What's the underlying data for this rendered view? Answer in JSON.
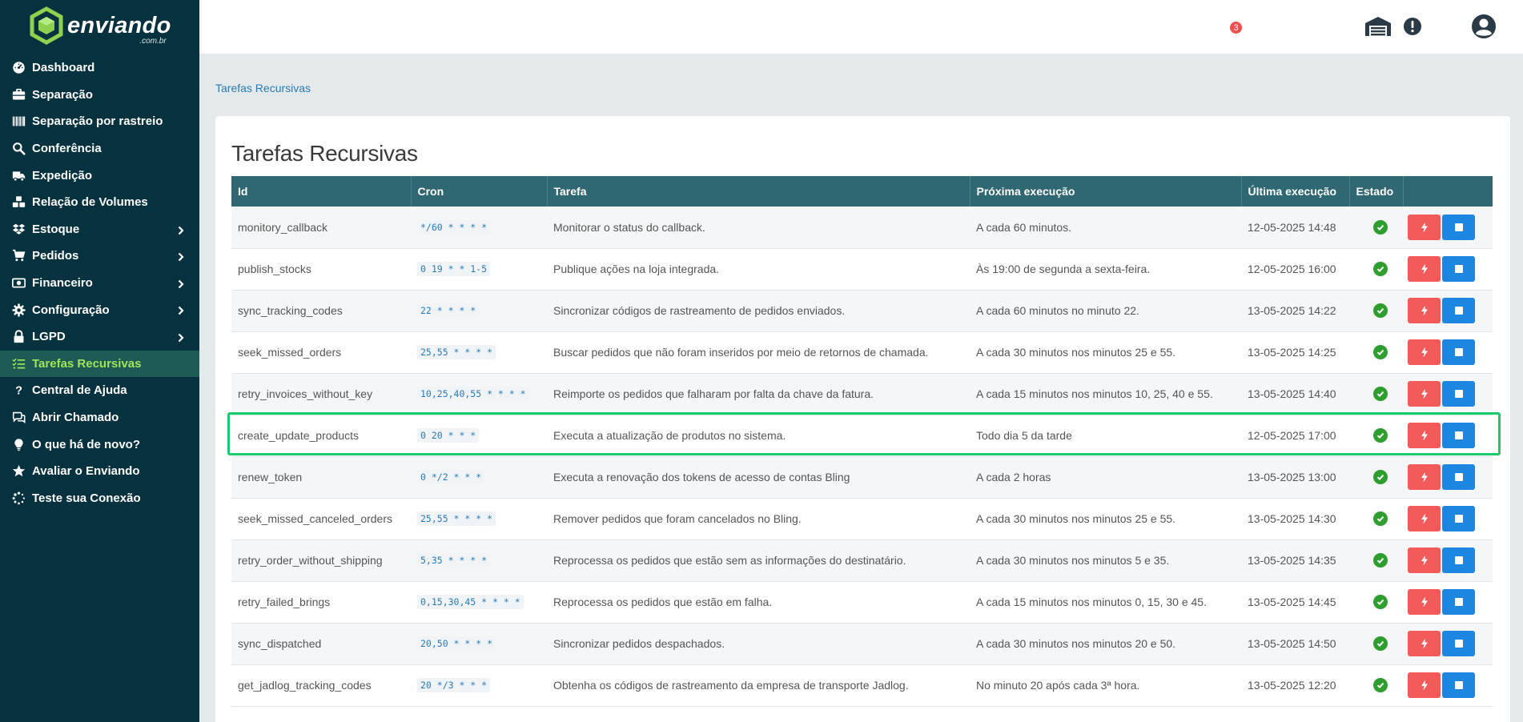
{
  "brand": {
    "name": "enviando",
    "sub": ".com.br"
  },
  "sidebar": {
    "items": [
      {
        "label": "Dashboard",
        "icon": "dashboard-icon",
        "chevron": false,
        "active": false
      },
      {
        "label": "Separação",
        "icon": "briefcase-icon",
        "chevron": false,
        "active": false
      },
      {
        "label": "Separação por rastreio",
        "icon": "barcode-icon",
        "chevron": false,
        "active": false
      },
      {
        "label": "Conferência",
        "icon": "search-icon",
        "chevron": false,
        "active": false
      },
      {
        "label": "Expedição",
        "icon": "truck-icon",
        "chevron": false,
        "active": false
      },
      {
        "label": "Relação de Volumes",
        "icon": "boxes-icon",
        "chevron": false,
        "active": false
      },
      {
        "label": "Estoque",
        "icon": "dropbox-icon",
        "chevron": true,
        "active": false
      },
      {
        "label": "Pedidos",
        "icon": "cart-icon",
        "chevron": true,
        "active": false
      },
      {
        "label": "Financeiro",
        "icon": "money-icon",
        "chevron": true,
        "active": false
      },
      {
        "label": "Configuração",
        "icon": "gear-icon",
        "chevron": true,
        "active": false
      },
      {
        "label": "LGPD",
        "icon": "lock-icon",
        "chevron": true,
        "active": false
      },
      {
        "label": "Tarefas Recursivas",
        "icon": "tasks-icon",
        "chevron": false,
        "active": true
      },
      {
        "label": "Central de Ajuda",
        "icon": "question-icon",
        "chevron": false,
        "active": false
      },
      {
        "label": "Abrir Chamado",
        "icon": "comments-icon",
        "chevron": false,
        "active": false
      },
      {
        "label": "O que há de novo?",
        "icon": "lightbulb-icon",
        "chevron": false,
        "active": false
      },
      {
        "label": "Avaliar o Enviando",
        "icon": "star-icon",
        "chevron": false,
        "active": false
      },
      {
        "label": "Teste sua Conexão",
        "icon": "spinner-icon",
        "chevron": false,
        "active": false
      }
    ]
  },
  "header": {
    "notifications_count": "3"
  },
  "breadcrumb": "Tarefas Recursivas",
  "page_title": "Tarefas Recursivas",
  "table": {
    "columns": [
      "Id",
      "Cron",
      "Tarefa",
      "Próxima execução",
      "Última execução",
      "Estado",
      ""
    ],
    "rows": [
      {
        "id": "monitory_callback",
        "cron": "*/60 * * * *",
        "task": "Monitorar o status do callback.",
        "next": "A cada 60 minutos.",
        "last": "12-05-2025 14:48"
      },
      {
        "id": "publish_stocks",
        "cron": "0 19 * * 1-5",
        "task": "Publique ações na loja integrada.",
        "next": "Às 19:00 de segunda a sexta-feira.",
        "last": "12-05-2025 16:00"
      },
      {
        "id": "sync_tracking_codes",
        "cron": "22 * * * *",
        "task": "Sincronizar códigos de rastreamento de pedidos enviados.",
        "next": "A cada 60 minutos no minuto 22.",
        "last": "13-05-2025 14:22"
      },
      {
        "id": "seek_missed_orders",
        "cron": "25,55 * * * *",
        "task": "Buscar pedidos que não foram inseridos por meio de retornos de chamada.",
        "next": "A cada 30 minutos nos minutos 25 e 55.",
        "last": "13-05-2025 14:25"
      },
      {
        "id": "retry_invoices_without_key",
        "cron": "10,25,40,55 * * * *",
        "task": "Reimporte os pedidos que falharam por falta da chave da fatura.",
        "next": "A cada 15 minutos nos minutos 10, 25, 40 e 55.",
        "last": "13-05-2025 14:40"
      },
      {
        "id": "create_update_products",
        "cron": "0 20 * * *",
        "task": "Executa a atualização de produtos no sistema.",
        "next": "Todo dia 5 da tarde",
        "last": "12-05-2025 17:00"
      },
      {
        "id": "renew_token",
        "cron": "0 */2 * * *",
        "task": "Executa a renovação dos tokens de acesso de contas Bling",
        "next": "A cada 2 horas",
        "last": "13-05-2025 13:00"
      },
      {
        "id": "seek_missed_canceled_orders",
        "cron": "25,55 * * * *",
        "task": "Remover pedidos que foram cancelados no Bling.",
        "next": "A cada 30 minutos nos minutos 25 e 55.",
        "last": "13-05-2025 14:30"
      },
      {
        "id": "retry_order_without_shipping",
        "cron": "5,35 * * * *",
        "task": "Reprocessa os pedidos que estão sem as informações do destinatário.",
        "next": "A cada 30 minutos nos minutos 5 e 35.",
        "last": "13-05-2025 14:35"
      },
      {
        "id": "retry_failed_brings",
        "cron": "0,15,30,45 * * * *",
        "task": "Reprocessa os pedidos que estão em falha.",
        "next": "A cada 15 minutos nos minutos 0, 15, 30 e 45.",
        "last": "13-05-2025 14:45"
      },
      {
        "id": "sync_dispatched",
        "cron": "20,50 * * * *",
        "task": "Sincronizar pedidos despachados.",
        "next": "A cada 30 minutos nos minutos 20 e 50.",
        "last": "13-05-2025 14:50"
      },
      {
        "id": "get_jadlog_tracking_codes",
        "cron": "20 */3 * * *",
        "task": "Obtenha os códigos de rastreamento da empresa de transporte Jadlog.",
        "next": "No minuto 20 após cada 3ª hora.",
        "last": "13-05-2025 12:20"
      }
    ],
    "highlighted_row": "create_update_products"
  },
  "colors": {
    "sidebar": "#06323f",
    "active": "#9fe45c",
    "header_row": "#2f6772",
    "run_button": "#f35b5b",
    "stop_button": "#1c86e0",
    "highlight": "#19cb6b"
  }
}
